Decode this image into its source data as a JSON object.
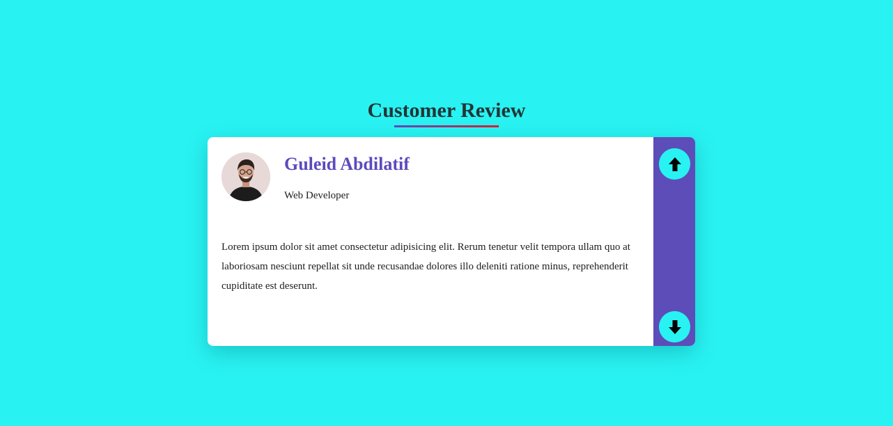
{
  "header": {
    "title": "Customer Review"
  },
  "review": {
    "name": "Guleid Abdilatif",
    "role": "Web Developer",
    "text": "Lorem ipsum dolor sit amet consectetur adipisicing elit. Rerum tenetur velit tempora ullam quo at laboriosam nesciunt repellat sit unde recusandae dolores illo deleniti ratione minus, reprehenderit cupiditate est deserunt."
  },
  "controls": {
    "up_icon": "arrow-up-icon",
    "down_icon": "arrow-down-icon"
  },
  "colors": {
    "background": "#29f2f2",
    "accent": "#5b4bbb",
    "sidebar": "#5d4db8",
    "underline_end": "#e31b2a"
  }
}
